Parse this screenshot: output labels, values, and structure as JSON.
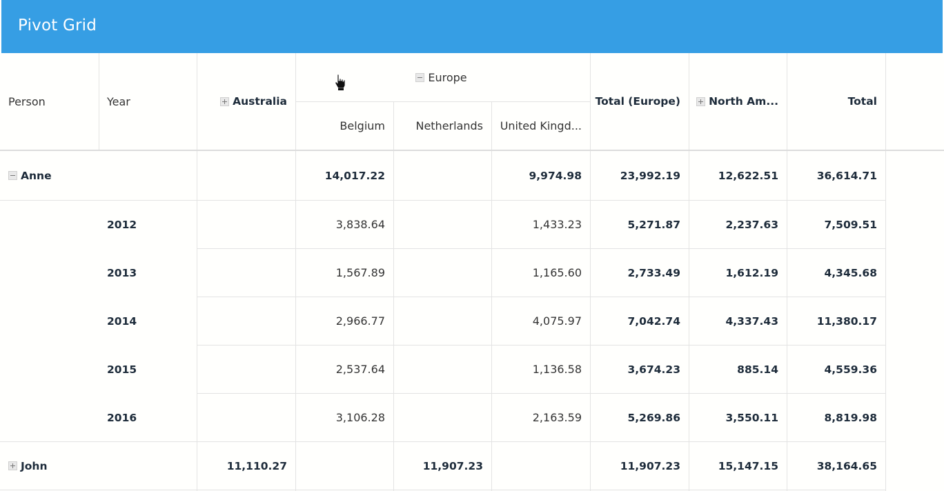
{
  "header": {
    "title": "Pivot Grid"
  },
  "columns_header": {
    "person": "Person",
    "year": "Year",
    "australia": "Australia",
    "europe": "Europe",
    "belgium": "Belgium",
    "netherlands": "Netherlands",
    "united_kingdom": "United Kingd...",
    "total_europe": "Total (Europe)",
    "north_america": "North Am...",
    "total": "Total"
  },
  "rows": [
    {
      "person": "Anne",
      "year": "",
      "australia": "",
      "belgium": "14,017.22",
      "netherlands": "",
      "uk": "9,974.98",
      "total_europe": "23,992.19",
      "north_america": "12,622.51",
      "total": "36,614.71"
    },
    {
      "person": "",
      "year": "2012",
      "australia": "",
      "belgium": "3,838.64",
      "netherlands": "",
      "uk": "1,433.23",
      "total_europe": "5,271.87",
      "north_america": "2,237.63",
      "total": "7,509.51"
    },
    {
      "person": "",
      "year": "2013",
      "australia": "",
      "belgium": "1,567.89",
      "netherlands": "",
      "uk": "1,165.60",
      "total_europe": "2,733.49",
      "north_america": "1,612.19",
      "total": "4,345.68"
    },
    {
      "person": "",
      "year": "2014",
      "australia": "",
      "belgium": "2,966.77",
      "netherlands": "",
      "uk": "4,075.97",
      "total_europe": "7,042.74",
      "north_america": "4,337.43",
      "total": "11,380.17"
    },
    {
      "person": "",
      "year": "2015",
      "australia": "",
      "belgium": "2,537.64",
      "netherlands": "",
      "uk": "1,136.58",
      "total_europe": "3,674.23",
      "north_america": "885.14",
      "total": "4,559.36"
    },
    {
      "person": "",
      "year": "2016",
      "australia": "",
      "belgium": "3,106.28",
      "netherlands": "",
      "uk": "2,163.59",
      "total_europe": "5,269.86",
      "north_america": "3,550.11",
      "total": "8,819.98"
    },
    {
      "person": "John",
      "year": "",
      "australia": "11,110.27",
      "belgium": "",
      "netherlands": "11,907.23",
      "uk": "",
      "total_europe": "11,907.23",
      "north_america": "15,147.15",
      "total": "38,164.65"
    }
  ]
}
